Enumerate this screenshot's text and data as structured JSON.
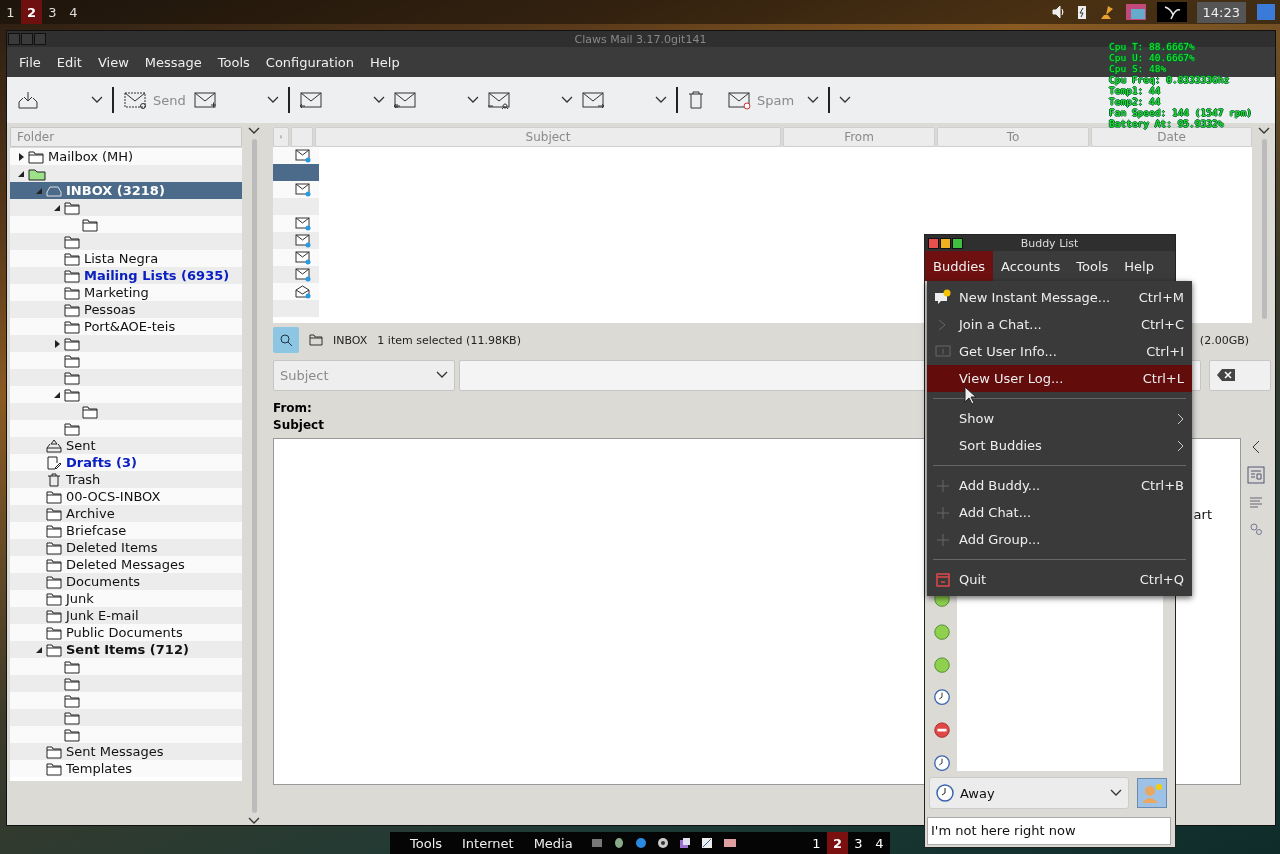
{
  "top_panel": {
    "workspaces": [
      {
        "label": "1",
        "selected": false
      },
      {
        "label": "2",
        "selected": true
      },
      {
        "label": "3",
        "selected": false
      },
      {
        "label": "4",
        "selected": false
      }
    ],
    "clock": "14:23"
  },
  "mail_window": {
    "title": "Claws Mail 3.17.0git141",
    "menu": [
      "File",
      "Edit",
      "View",
      "Message",
      "Tools",
      "Configuration",
      "Help"
    ],
    "toolbar": [
      {
        "kind": "fetch",
        "dropdown": true
      },
      {
        "kind": "separator"
      },
      {
        "kind": "send",
        "label": "Send",
        "dropdown": false
      },
      {
        "kind": "compose",
        "dropdown": true
      },
      {
        "kind": "separator"
      },
      {
        "kind": "reply",
        "dropdown": true
      },
      {
        "kind": "replyall",
        "dropdown": true
      },
      {
        "kind": "replysender",
        "dropdown": true
      },
      {
        "kind": "forward",
        "dropdown": true
      },
      {
        "kind": "separator"
      },
      {
        "kind": "trash",
        "dropdown": false
      },
      {
        "kind": "spam",
        "label": "Spam",
        "dropdown": true
      },
      {
        "kind": "separator"
      },
      {
        "kind": "overflow"
      }
    ],
    "folder_header": "Folder",
    "folders": [
      {
        "label": "Mailbox (MH)",
        "kind": "folder",
        "expanded": false,
        "selected": false,
        "unread": false,
        "bold": false
      },
      {
        "kind": "account",
        "expanded": true,
        "selected": false,
        "children": [
          {
            "label": "INBOX (3218)",
            "kind": "inbox",
            "expanded": true,
            "selected": true,
            "unread": false,
            "bold": true,
            "children": [
              {
                "kind": "folder",
                "expanded": true,
                "selected": false,
                "children": [
                  {
                    "kind": "folder",
                    "selected": false
                  }
                ]
              },
              {
                "kind": "folder",
                "selected": false
              },
              {
                "label": "Lista Negra",
                "kind": "folder",
                "selected": false,
                "unread": false,
                "bold": false
              },
              {
                "label": "Mailing Lists (6935)",
                "kind": "folder",
                "selected": false,
                "unread": true,
                "bold": true
              },
              {
                "label": "Marketing",
                "kind": "folder",
                "selected": false,
                "unread": false,
                "bold": false
              },
              {
                "label": "Pessoas",
                "kind": "folder",
                "selected": false,
                "unread": false,
                "bold": false
              },
              {
                "label": "Port&AOE-teis",
                "kind": "folder",
                "selected": false,
                "unread": false,
                "bold": false
              },
              {
                "kind": "folder",
                "expanded": false,
                "selected": false
              },
              {
                "kind": "folder",
                "selected": false
              },
              {
                "kind": "folder",
                "selected": false
              },
              {
                "kind": "folder",
                "expanded": true,
                "selected": false,
                "children": [
                  {
                    "kind": "folder",
                    "selected": false
                  }
                ]
              },
              {
                "kind": "folder",
                "selected": false
              }
            ]
          },
          {
            "label": "Sent",
            "kind": "sent",
            "selected": false,
            "unread": false,
            "bold": false
          },
          {
            "label": "Drafts (3)",
            "kind": "drafts",
            "selected": false,
            "unread": true,
            "bold": true
          },
          {
            "label": "Trash",
            "kind": "trash",
            "selected": false,
            "unread": false,
            "bold": false
          },
          {
            "label": "00-OCS-INBOX",
            "kind": "folder",
            "selected": false,
            "unread": false,
            "bold": false
          },
          {
            "label": "Archive",
            "kind": "folder",
            "selected": false,
            "unread": false,
            "bold": false
          },
          {
            "label": "Briefcase",
            "kind": "folder",
            "selected": false,
            "unread": false,
            "bold": false
          },
          {
            "label": "Deleted Items",
            "kind": "folder",
            "selected": false,
            "unread": false,
            "bold": false
          },
          {
            "label": "Deleted Messages",
            "kind": "folder",
            "selected": false,
            "unread": false,
            "bold": false
          },
          {
            "label": "Documents",
            "kind": "folder",
            "selected": false,
            "unread": false,
            "bold": false
          },
          {
            "label": "Junk",
            "kind": "folder",
            "selected": false,
            "unread": false,
            "bold": false
          },
          {
            "label": "Junk E-mail",
            "kind": "folder",
            "selected": false,
            "unread": false,
            "bold": false
          },
          {
            "label": "Public Documents",
            "kind": "folder",
            "selected": false,
            "unread": false,
            "bold": false
          },
          {
            "label": "Sent Items (712)",
            "kind": "folder",
            "expanded": true,
            "selected": false,
            "unread": false,
            "bold": true,
            "children": [
              {
                "kind": "folder",
                "selected": false
              },
              {
                "kind": "folder",
                "selected": false
              },
              {
                "kind": "folder",
                "selected": false
              },
              {
                "kind": "folder",
                "selected": false
              },
              {
                "kind": "folder",
                "selected": false
              }
            ]
          },
          {
            "label": "Sent Messages",
            "kind": "folder",
            "selected": false,
            "unread": false,
            "bold": false
          },
          {
            "label": "Templates",
            "kind": "folder",
            "selected": false,
            "unread": false,
            "bold": false
          }
        ]
      }
    ],
    "message_list": {
      "columns": [
        {
          "kind": "mark"
        },
        {
          "kind": "status"
        },
        {
          "kind": "text",
          "label": "Subject"
        },
        {
          "kind": "text",
          "label": "From"
        },
        {
          "kind": "text",
          "label": "To"
        },
        {
          "kind": "text",
          "label": "Date"
        }
      ],
      "rows": [
        {
          "kind": "unread",
          "selected": false
        },
        {
          "kind": "blank",
          "selected": true
        },
        {
          "kind": "unread",
          "selected": false
        },
        {
          "kind": "blank",
          "selected": false
        },
        {
          "kind": "unread",
          "selected": false
        },
        {
          "kind": "unread",
          "selected": false
        },
        {
          "kind": "unread",
          "selected": false
        },
        {
          "kind": "unread",
          "selected": false
        },
        {
          "kind": "opened",
          "selected": false
        },
        {
          "kind": "blank",
          "selected": false
        }
      ]
    },
    "status": {
      "folder": "INBOX",
      "selection": "1 item selected (11.98KB)",
      "quota": "(2.00GB)"
    },
    "search": {
      "scope": "Subject"
    },
    "header_labels": [
      "From:",
      "Subject"
    ],
    "preview_fragment": "art"
  },
  "buddy_window": {
    "title": "Buddy List",
    "menu": [
      {
        "label": "Buddies",
        "selected": true
      },
      {
        "label": "Accounts",
        "selected": false
      },
      {
        "label": "Tools",
        "selected": false
      },
      {
        "label": "Help",
        "selected": false
      }
    ],
    "buddies": [
      {
        "kind": "available"
      },
      {
        "kind": "available"
      },
      {
        "kind": "available"
      },
      {
        "kind": "away"
      },
      {
        "kind": "busy"
      },
      {
        "kind": "away"
      }
    ],
    "status_choice": {
      "kind": "away",
      "label": "Away"
    },
    "status_message": "I'm not here right now"
  },
  "buddies_menu": [
    {
      "kind": "message",
      "label": "New Instant Message...",
      "shortcut": "Ctrl+M",
      "selected": false
    },
    {
      "kind": "chat",
      "label": "Join a Chat...",
      "shortcut": "Ctrl+C",
      "selected": false
    },
    {
      "kind": "info",
      "label": "Get User Info...",
      "shortcut": "Ctrl+I",
      "selected": false
    },
    {
      "kind": "plain",
      "label": "View User Log...",
      "shortcut": "Ctrl+L",
      "selected": true
    },
    {
      "kind": "separator"
    },
    {
      "kind": "submenu",
      "label": "Show",
      "selected": false
    },
    {
      "kind": "submenu",
      "label": "Sort Buddies",
      "selected": false
    },
    {
      "kind": "separator"
    },
    {
      "kind": "add",
      "label": "Add Buddy...",
      "shortcut": "Ctrl+B",
      "selected": false
    },
    {
      "kind": "add",
      "label": "Add Chat...",
      "selected": false
    },
    {
      "kind": "add",
      "label": "Add Group...",
      "selected": false
    },
    {
      "kind": "separator"
    },
    {
      "kind": "quit",
      "label": "Quit",
      "shortcut": "Ctrl+Q",
      "selected": false
    }
  ],
  "system_monitor": [
    "Cpu T: 88.6667%",
    "Cpu U: 40.6667%",
    "Cpu S: 48%",
    "Cpu Freq: 0.833333Ghz",
    "Temp1: 44",
    "Temp2: 44",
    "Fan Speed: 144 (1547 rpm)",
    "Battery At: 95.9332%"
  ],
  "taskbar": {
    "menus": [
      "Tools",
      "Internet",
      "Media"
    ],
    "workspaces": [
      {
        "label": "1",
        "selected": false
      },
      {
        "label": "2",
        "selected": true
      },
      {
        "label": "3",
        "selected": false
      },
      {
        "label": "4",
        "selected": false
      }
    ]
  }
}
